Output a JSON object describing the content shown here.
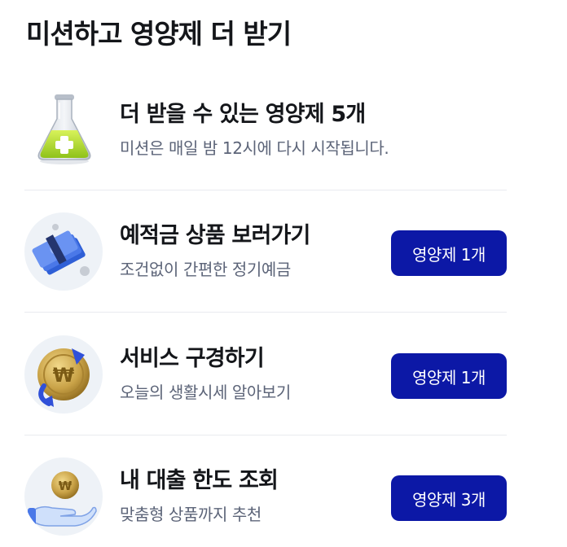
{
  "header": {
    "title": "미션하고 영양제 더 받기"
  },
  "summary": {
    "title": "더 받을 수 있는 영양제 5개",
    "subtitle": "미션은 매일 밤 12시에 다시 시작됩니다.",
    "icon": "flask-plus-icon"
  },
  "missions": [
    {
      "title": "예적금 상품 보러가기",
      "subtitle": "조건없이 간편한 정기예금",
      "reward_label": "영양제 1개",
      "icon": "money-stack-icon"
    },
    {
      "title": "서비스 구경하기",
      "subtitle": "오늘의 생활시세 알아보기",
      "reward_label": "영양제 1개",
      "icon": "won-coin-exchange-icon"
    },
    {
      "title": "내 대출 한도 조회",
      "subtitle": "맞춤형 상품까지 추천",
      "reward_label": "영양제 3개",
      "icon": "hand-coin-icon"
    }
  ],
  "colors": {
    "button_bg": "#0c18a6",
    "button_text": "#ffffff",
    "subtitle_text": "#5c6478",
    "icon_circle_bg": "#eef2f7"
  }
}
